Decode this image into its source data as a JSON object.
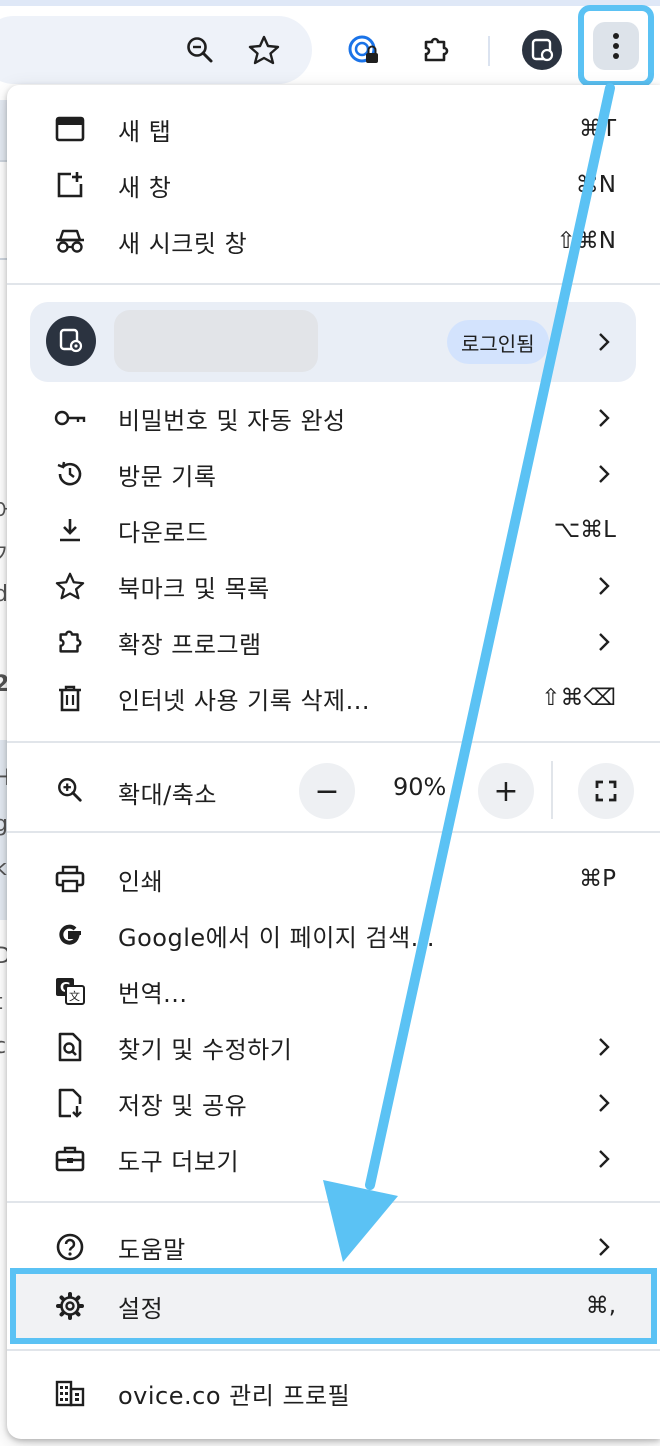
{
  "toolbar": {
    "icons": [
      "zoom-icon",
      "bookmark-star-icon",
      "password-manager-icon",
      "extensions-icon",
      "profile-icon",
      "more-menu-icon"
    ]
  },
  "page_fragments": [
    "어",
    "기",
    "d",
    "2",
    "H",
    "g",
    "k",
    "D",
    "t",
    "c"
  ],
  "menu": {
    "new_tab": {
      "label": "새 탭",
      "shortcut": "⌘T"
    },
    "new_window": {
      "label": "새 창",
      "shortcut": "⌘N"
    },
    "incognito": {
      "label": "새 시크릿 창",
      "shortcut": "⇧⌘N"
    },
    "profile": {
      "status": "로그인됨"
    },
    "passwords": {
      "label": "비밀번호 및 자동 완성"
    },
    "history": {
      "label": "방문 기록"
    },
    "downloads": {
      "label": "다운로드",
      "shortcut": "⌥⌘L"
    },
    "bookmarks": {
      "label": "북마크 및 목록"
    },
    "extensions": {
      "label": "확장 프로그램"
    },
    "clear_data": {
      "label": "인터넷 사용 기록 삭제...",
      "shortcut": "⇧⌘⌫"
    },
    "zoom": {
      "label": "확대/축소",
      "minus": "−",
      "value": "90%",
      "plus": "+"
    },
    "print": {
      "label": "인쇄",
      "shortcut": "⌘P"
    },
    "google_search": {
      "label": "Google에서 이 페이지 검색..."
    },
    "translate": {
      "label": "번역..."
    },
    "find_edit": {
      "label": "찾기 및 수정하기"
    },
    "save_share": {
      "label": "저장 및 공유"
    },
    "more_tools": {
      "label": "도구 더보기"
    },
    "help": {
      "label": "도움말"
    },
    "settings": {
      "label": "설정",
      "shortcut": "⌘,"
    },
    "managed": {
      "label": "ovice.co 관리 프로필"
    }
  },
  "colors": {
    "highlight": "#5bc2f4",
    "menu_bg": "#ffffff",
    "profile_bg": "#e9eef6",
    "signed_badge": "#d3e3fd"
  }
}
